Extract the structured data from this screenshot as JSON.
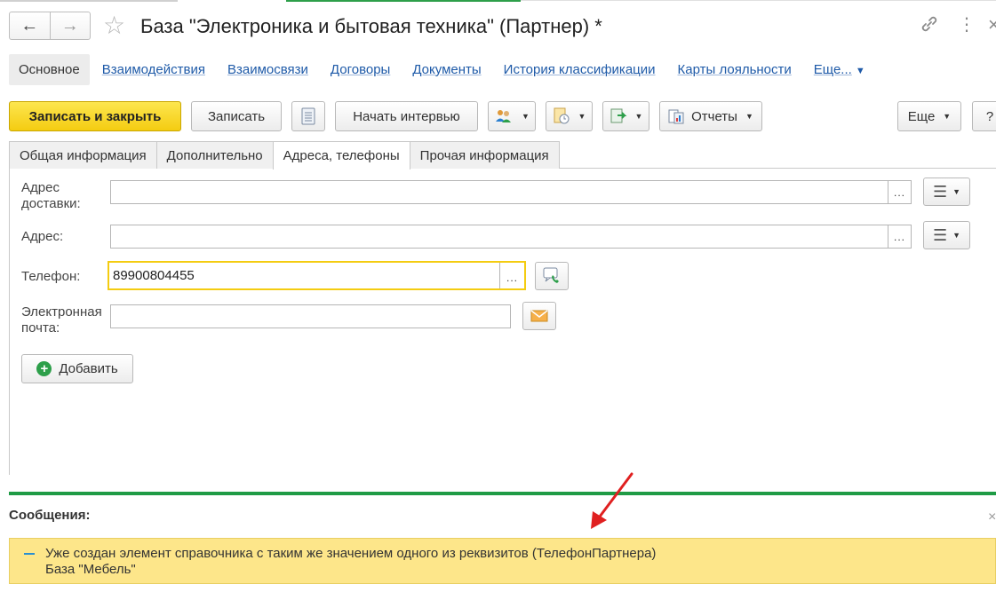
{
  "window": {
    "title": "База \"Электроника и бытовая техника\" (Партнер) *",
    "nav_back": "←",
    "nav_forward": "→",
    "star": "☆",
    "link_icon": "🔗",
    "more_icon": "⋮",
    "close_icon": "×"
  },
  "nav": {
    "active": "Основное",
    "links": [
      "Взаимодействия",
      "Взаимосвязи",
      "Договоры",
      "Документы",
      "История классификации",
      "Карты лояльности"
    ],
    "more": "Еще...",
    "more_arrow": "▼"
  },
  "toolbar": {
    "save_close": "Записать и закрыть",
    "save": "Записать",
    "start_interview": "Начать интервью",
    "reports": "Отчеты",
    "more": "Еще",
    "help": "?",
    "dropdown_arrow": "▼"
  },
  "tabs": [
    "Общая информация",
    "Дополнительно",
    "Адреса, телефоны",
    "Прочая информация"
  ],
  "form": {
    "delivery_label_1": "Адрес",
    "delivery_label_2": "доставки:",
    "delivery_value": "",
    "address_label": "Адрес:",
    "address_value": "",
    "phone_label": "Телефон:",
    "phone_value": "89900804455",
    "email_label_1": "Электронная",
    "email_label_2": "почта:",
    "email_value": "",
    "ellipsis": "...",
    "menu_icon": "☰",
    "add_label": "Добавить",
    "add_icon": "+"
  },
  "messages": {
    "title": "Сообщения:",
    "close": "×",
    "line1": "Уже создан элемент справочника с таким же значением одного из реквизитов (ТелефонПартнера)",
    "line2": "База \"Мебель\""
  },
  "colors": {
    "accent_yellow": "#f4cc11",
    "link_blue": "#1e5aa8",
    "green_bar": "#1f9b45",
    "message_bg": "#fde68a",
    "arrow_red": "#e02020"
  }
}
